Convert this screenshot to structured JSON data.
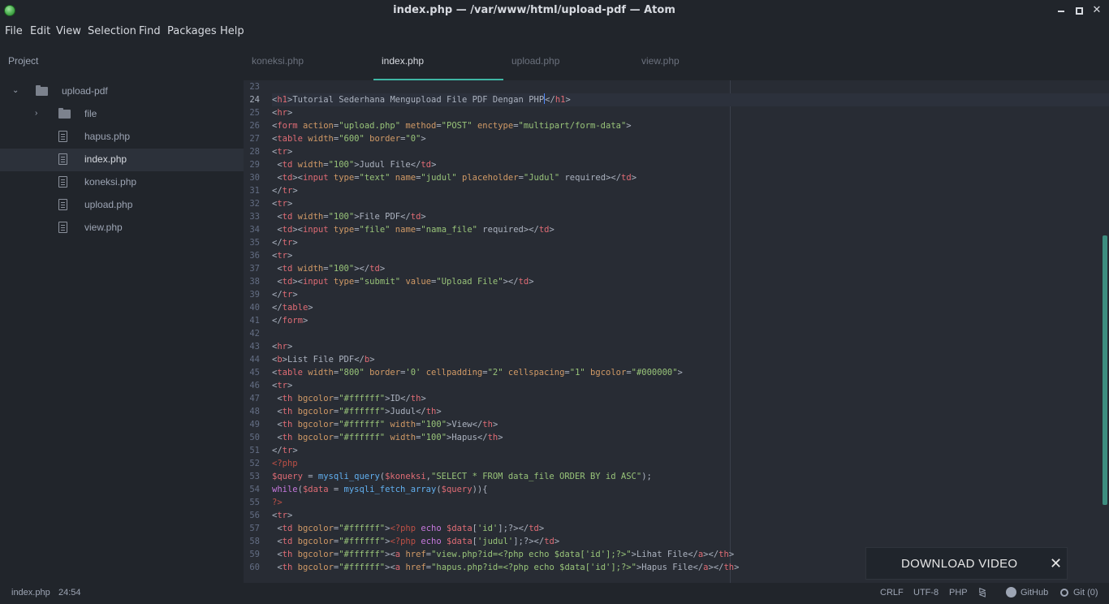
{
  "window": {
    "title": "index.php — /var/www/html/upload-pdf — Atom"
  },
  "menu": [
    "File",
    "Edit",
    "View",
    "Selection",
    "Find",
    "Packages",
    "Help"
  ],
  "sidebar": {
    "title": "Project",
    "root": "upload-pdf",
    "items": [
      {
        "label": "file",
        "kind": "folder"
      },
      {
        "label": "hapus.php",
        "kind": "file"
      },
      {
        "label": "index.php",
        "kind": "file",
        "selected": true
      },
      {
        "label": "koneksi.php",
        "kind": "file"
      },
      {
        "label": "upload.php",
        "kind": "file"
      },
      {
        "label": "view.php",
        "kind": "file"
      }
    ]
  },
  "tabs": [
    {
      "label": "koneksi.php"
    },
    {
      "label": "index.php",
      "active": true
    },
    {
      "label": "upload.php"
    },
    {
      "label": "view.php"
    }
  ],
  "editor": {
    "first_line": 23,
    "cursor_line": 24,
    "lines": [
      "",
      "<h1>Tutorial Sederhana Mengupload File PDF Dengan PHP</h1>",
      "<hr>",
      "<form action=\"upload.php\" method=\"POST\" enctype=\"multipart/form-data\">",
      "<table width=\"600\" border=\"0\">",
      "<tr>",
      " <td width=\"100\">Judul File</td>",
      " <td><input type=\"text\" name=\"judul\" placeholder=\"Judul\" required></td>",
      "</tr>",
      "<tr>",
      " <td width=\"100\">File PDF</td>",
      " <td><input type=\"file\" name=\"nama_file\" required></td>",
      "</tr>",
      "<tr>",
      " <td width=\"100\"></td>",
      " <td><input type=\"submit\" value=\"Upload File\"></td>",
      "</tr>",
      "</table>",
      "</form>",
      "",
      "<hr>",
      "<b>List File PDF</b>",
      "<table width=\"800\" border='0' cellpadding=\"2\" cellspacing=\"1\" bgcolor=\"#000000\">",
      "<tr>",
      " <th bgcolor=\"#ffffff\">ID</th>",
      " <th bgcolor=\"#ffffff\">Judul</th>",
      " <th bgcolor=\"#ffffff\" width=\"100\">View</th>",
      " <th bgcolor=\"#ffffff\" width=\"100\">Hapus</th>",
      "</tr>",
      "<?php",
      "$query = mysqli_query($koneksi,\"SELECT * FROM data_file ORDER BY id ASC\");",
      "while($data = mysqli_fetch_array($query)){",
      "?>",
      "<tr>",
      " <td bgcolor=\"#ffffff\"><?php echo $data['id'];?></td>",
      " <td bgcolor=\"#ffffff\"><?php echo $data['judul'];?></td>",
      " <th bgcolor=\"#ffffff\"><a href=\"view.php?id=<?php echo $data['id'];?>\">Lihat File</a></th>",
      " <th bgcolor=\"#ffffff\"><a href=\"hapus.php?id=<?php echo $data['id'];?>\">Hapus File</a></th>"
    ]
  },
  "status": {
    "file": "index.php",
    "cursor": "24:54",
    "line_ending": "CRLF",
    "encoding": "UTF-8",
    "grammar": "PHP",
    "github": "GitHub",
    "git": "Git (0)"
  },
  "overlay": {
    "label": "DOWNLOAD VIDEO"
  },
  "colors": {
    "accent": "#3fb6a5",
    "background": "#282c34",
    "panel": "#21252b"
  }
}
